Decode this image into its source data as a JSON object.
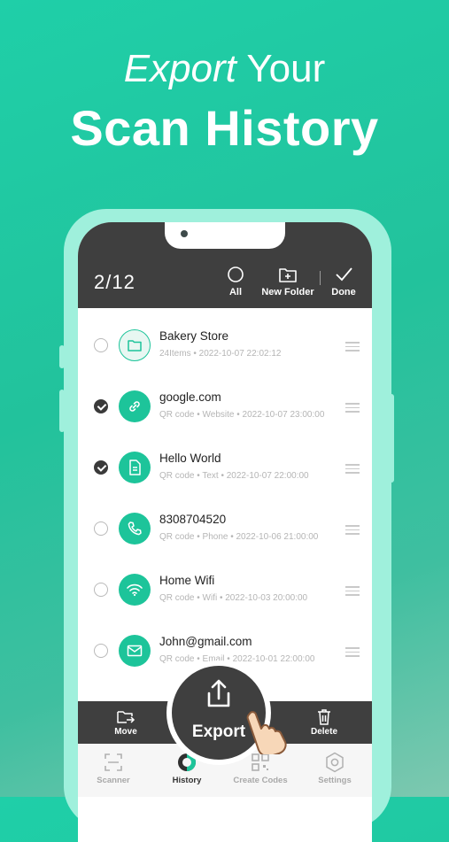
{
  "headline": {
    "line1_em": "Export",
    "line1_rest": " Your",
    "line2": "Scan History"
  },
  "topbar": {
    "count": "2/12",
    "all_label": "All",
    "new_folder_label": "New Folder",
    "done_label": "Done"
  },
  "items": [
    {
      "title": "Bakery Store",
      "sub": "24Items • 2022-10-07 22:02:12",
      "checked": false,
      "icon": "folder-icon"
    },
    {
      "title": "google.com",
      "sub": "QR code • Website • 2022-10-07 23:00:00",
      "checked": true,
      "icon": "link-icon"
    },
    {
      "title": "Hello World",
      "sub": "QR code • Text • 2022-10-07 22:00:00",
      "checked": true,
      "icon": "document-icon"
    },
    {
      "title": "8308704520",
      "sub": "QR code • Phone • 2022-10-06 21:00:00",
      "checked": false,
      "icon": "phone-icon"
    },
    {
      "title": "Home Wifi",
      "sub": "QR code • Wifi • 2022-10-03 20:00:00",
      "checked": false,
      "icon": "wifi-icon"
    },
    {
      "title": "John@gmail.com",
      "sub": "QR code • Email • 2022-10-01 22:00:00",
      "checked": false,
      "icon": "mail-icon"
    }
  ],
  "actions": {
    "move_label": "Move",
    "export_label": "Export",
    "delete_label": "Delete"
  },
  "tabs": [
    {
      "label": "Scanner",
      "active": false,
      "icon": "scanner-icon"
    },
    {
      "label": "History",
      "active": true,
      "icon": "history-icon"
    },
    {
      "label": "Create Codes",
      "active": false,
      "icon": "qr-code-icon"
    },
    {
      "label": "Settings",
      "active": false,
      "icon": "settings-icon"
    }
  ],
  "colors": {
    "accent": "#1dc49a",
    "dark": "#3f3f3f",
    "background": "#22c29c"
  }
}
